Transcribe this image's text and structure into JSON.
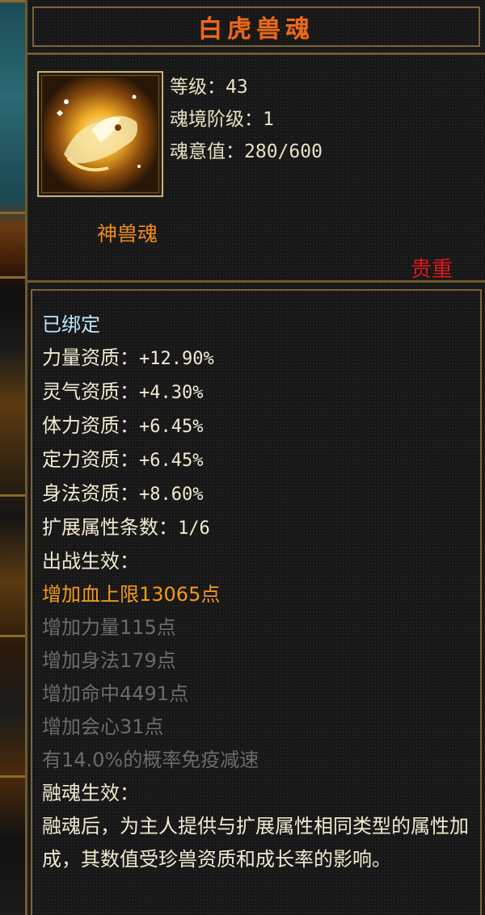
{
  "tooltip": {
    "title": "白虎兽魂",
    "stats": [
      {
        "label": "等级：",
        "value": "43"
      },
      {
        "label": "魂境阶级：",
        "value": "1"
      },
      {
        "label": "魂意值：",
        "value": "280/600"
      }
    ],
    "type": "神兽魂",
    "quality": "贵重",
    "bound": "已绑定",
    "attributes": [
      {
        "label": "力量资质：",
        "value": "+12.90%"
      },
      {
        "label": "灵气资质：",
        "value": "+4.30%"
      },
      {
        "label": "体力资质：",
        "value": "+6.45%"
      },
      {
        "label": "定力资质：",
        "value": "+6.45%"
      },
      {
        "label": "身法资质：",
        "value": "+8.60%"
      }
    ],
    "ext_count": {
      "label": "扩展属性条数：",
      "value": "1/6"
    },
    "battle_header": "出战生效：",
    "battle_active": [
      "增加血上限13065点"
    ],
    "battle_inactive": [
      "增加力量115点",
      "增加身法179点",
      "增加命中4491点",
      "增加会心31点",
      "有14.0%的概率免疫减速"
    ],
    "fusion_header": "融魂生效：",
    "fusion_desc": "融魂后，为主人提供与扩展属性相同类型的属性加成，其数值受珍兽资质和成长率的影响。"
  },
  "colors": {
    "title": "#e86a1c",
    "type": "#f08a1c",
    "quality": "#e01818",
    "bound": "#bfe8ff",
    "active": "#f59a1a",
    "inactive": "#6b6b6b",
    "border": "#7a653a"
  },
  "icons": {
    "item_icon": "white-tiger-soul-icon"
  }
}
